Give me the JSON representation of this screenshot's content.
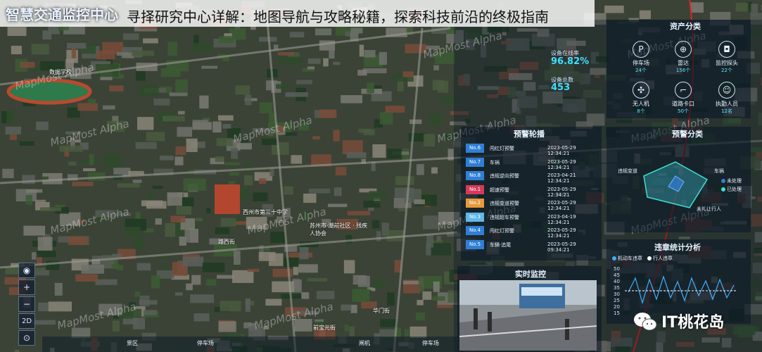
{
  "app": {
    "brand": "智慧交通监控中心",
    "headline": "寻择研究中心详解：地图导航与攻略秘籍，探索科技前沿的终极指南"
  },
  "watermark": "MapMost Alpha",
  "map_labels": [
    "数据学校",
    "西州市第三十中学",
    "苏州市·潮前社区 · 残疾人协会",
    "路西街",
    "前宝元街",
    "华门街"
  ],
  "map_controls": [
    {
      "icon": "globe-icon",
      "label": "◉"
    },
    {
      "icon": "zoom-in-icon",
      "label": "+"
    },
    {
      "icon": "zoom-out-icon",
      "label": "−"
    },
    {
      "icon": "view-2d",
      "label": "2D"
    },
    {
      "icon": "compass-icon",
      "label": "⊙"
    }
  ],
  "stats": {
    "online_label": "设备在线率",
    "online_value": "96.82%",
    "total_label": "设备总数",
    "total_value": "453"
  },
  "assets": {
    "title": "资产分类",
    "items": [
      {
        "icon": "parking-icon",
        "glyph": "P",
        "label": "停车场",
        "count": "24个"
      },
      {
        "icon": "radar-icon",
        "glyph": "⊕",
        "label": "雷达",
        "count": "156个"
      },
      {
        "icon": "camera-icon",
        "glyph": "◘",
        "label": "监控探头",
        "count": "22个"
      },
      {
        "icon": "drone-icon",
        "glyph": "✣",
        "label": "无人机",
        "count": "8个"
      },
      {
        "icon": "checkpoint-icon",
        "glyph": "⌐",
        "label": "道路卡口",
        "count": "50个"
      },
      {
        "icon": "staff-icon",
        "glyph": "☺",
        "label": "执勤人员",
        "count": "12名"
      }
    ]
  },
  "alerts": {
    "title": "预警轮播",
    "rows": [
      {
        "no": "No.6",
        "name": "闯红灯预警",
        "time": "2023-05-29 12:34:21",
        "color": "#2f7fd6"
      },
      {
        "no": "No.7",
        "name": "车祸",
        "time": "2023-05-29 12:34:21",
        "color": "#2f7fd6"
      },
      {
        "no": "No.8",
        "name": "违规逆向预警",
        "time": "2023-04-21 12:34:21",
        "color": "#2f7fd6"
      },
      {
        "no": "No.1",
        "name": "超速预警",
        "time": "2023-05-29 12:34:21",
        "color": "#d43b5a"
      },
      {
        "no": "No.2",
        "name": "违规变道预警",
        "time": "2023-05-29 12:34:21",
        "color": "#e59a3c"
      },
      {
        "no": "No.3",
        "name": "违规超车预警",
        "time": "2023-04-19 12:34:21",
        "color": "#61b8e8"
      },
      {
        "no": "No.4",
        "name": "闯红灯预警",
        "time": "2023-05-29 12:34:21",
        "color": "#2f7fd6"
      },
      {
        "no": "No.5",
        "name": "车辆·追尾",
        "time": "2023-05-29 09:34:21",
        "color": "#2f7fd6"
      }
    ]
  },
  "alert_class": {
    "title": "预警分类",
    "labels": [
      "违规变道",
      "车祸",
      "未礼让行人"
    ],
    "legend": [
      "未处理",
      "已处理"
    ],
    "legend_colors": [
      "#2f7fd6",
      "#3fe1d0"
    ]
  },
  "realtime": {
    "title": "实时监控"
  },
  "violations": {
    "title": "违章统计分析",
    "legend": [
      "机动车违章",
      "行人违章"
    ],
    "legend_colors": [
      "#3fb0ff",
      "#ffffff"
    ],
    "y_ticks": [
      "50",
      "45",
      "40",
      "35",
      "30",
      "25",
      "20",
      "15"
    ]
  },
  "toolbar": {
    "items": [
      "景区",
      "停车场",
      "闸机",
      "停车场"
    ]
  },
  "wechat": {
    "label": "IT桃花岛"
  }
}
